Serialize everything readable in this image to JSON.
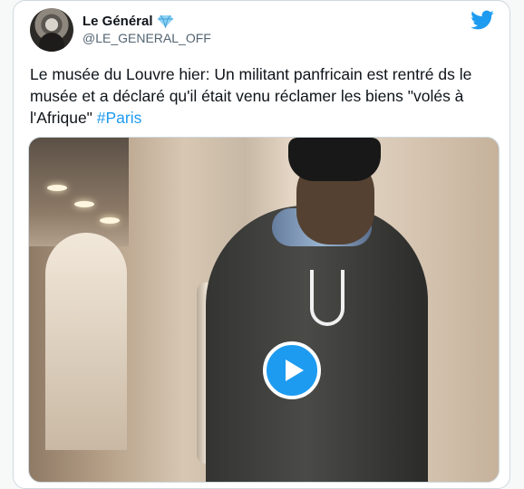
{
  "author": {
    "name": "Le Général",
    "handle": "@LE_GENERAL_OFF",
    "verified_icon": "diamond-icon"
  },
  "tweet": {
    "text": "Le musée du Louvre hier: Un militant panfricain est rentré ds le musée et a déclaré qu'il était venu réclamer les biens \"volés à l'Afrique\" ",
    "hashtag": "#Paris"
  },
  "icons": {
    "platform": "twitter-bird-icon",
    "media_action": "play-icon"
  },
  "colors": {
    "brand": "#1d9bf0",
    "text": "#0f1419",
    "secondary_text": "#536471",
    "background": "#ffffff"
  }
}
